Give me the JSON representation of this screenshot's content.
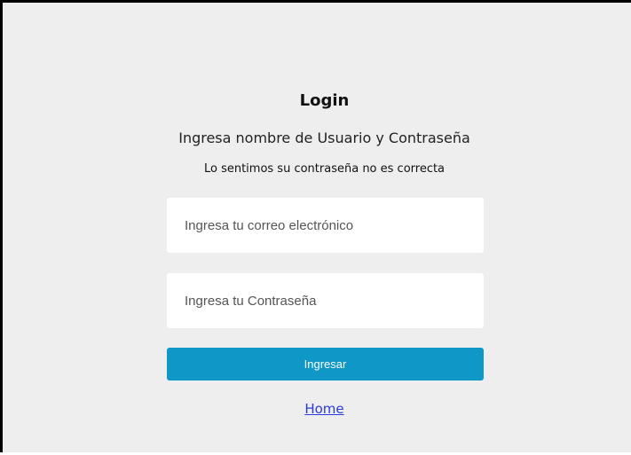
{
  "login": {
    "title": "Login",
    "subtitle": "Ingresa nombre de Usuario y Contraseña",
    "error_message": "Lo sentimos su contraseña no es correcta",
    "email": {
      "placeholder": "Ingresa tu correo electrónico",
      "value": ""
    },
    "password": {
      "placeholder": "Ingresa tu Contraseña",
      "value": ""
    },
    "submit_label": "Ingresar",
    "home_link": "Home"
  },
  "colors": {
    "background": "#eeeeee",
    "button": "#0f97c8",
    "link": "#2a3bdc"
  }
}
